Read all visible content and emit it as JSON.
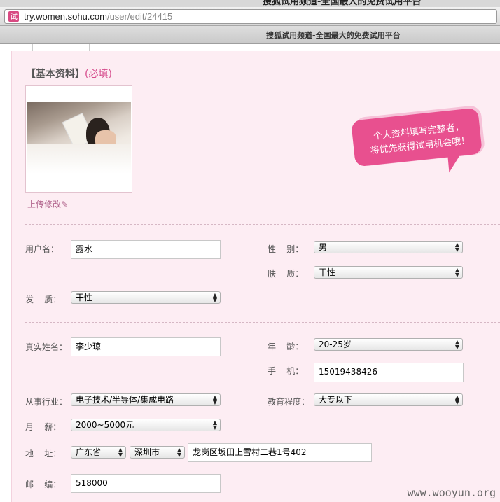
{
  "browser": {
    "window_title": "搜狐试用频道-全国最大的免费试用平台",
    "url_host": "try.women.sohu.com",
    "url_path": "/user/edit/24415",
    "favicon_text": "试",
    "tab_title": "搜狐试用频道-全国最大的免费试用平台"
  },
  "form": {
    "section_title": "【基本资料】",
    "section_required": "(必填)",
    "upload_label": "上传修改",
    "bubble_line1": "个人资料填写完整者，",
    "bubble_line2": "将优先获得试用机会哦！",
    "username": {
      "label": "用户名：",
      "value": "露水"
    },
    "gender": {
      "label": "性    别：",
      "value": "男"
    },
    "skin": {
      "label": "肤    质：",
      "value": "干性"
    },
    "hair": {
      "label": "发    质：",
      "value": "干性"
    },
    "realname": {
      "label": "真实姓名：",
      "value": "李少琼"
    },
    "age": {
      "label": "年    龄：",
      "value": "20-25岁"
    },
    "phone": {
      "label": "手    机：",
      "value": "15019438426"
    },
    "industry": {
      "label": "从事行业：",
      "value": "电子技术/半导体/集成电路"
    },
    "education": {
      "label": "教育程度：",
      "value": "大专以下"
    },
    "salary": {
      "label": "月    薪：",
      "value": "2000~5000元"
    },
    "address": {
      "label": "地    址：",
      "province": "广东省",
      "city": "深圳市",
      "detail": "龙岗区坂田上雪村二巷1号402"
    },
    "zipcode": {
      "label": "邮    编：",
      "value": "518000"
    }
  },
  "watermark": "www.wooyun.org",
  "colors": {
    "accent": "#e8508f",
    "background": "#fdedf3"
  }
}
